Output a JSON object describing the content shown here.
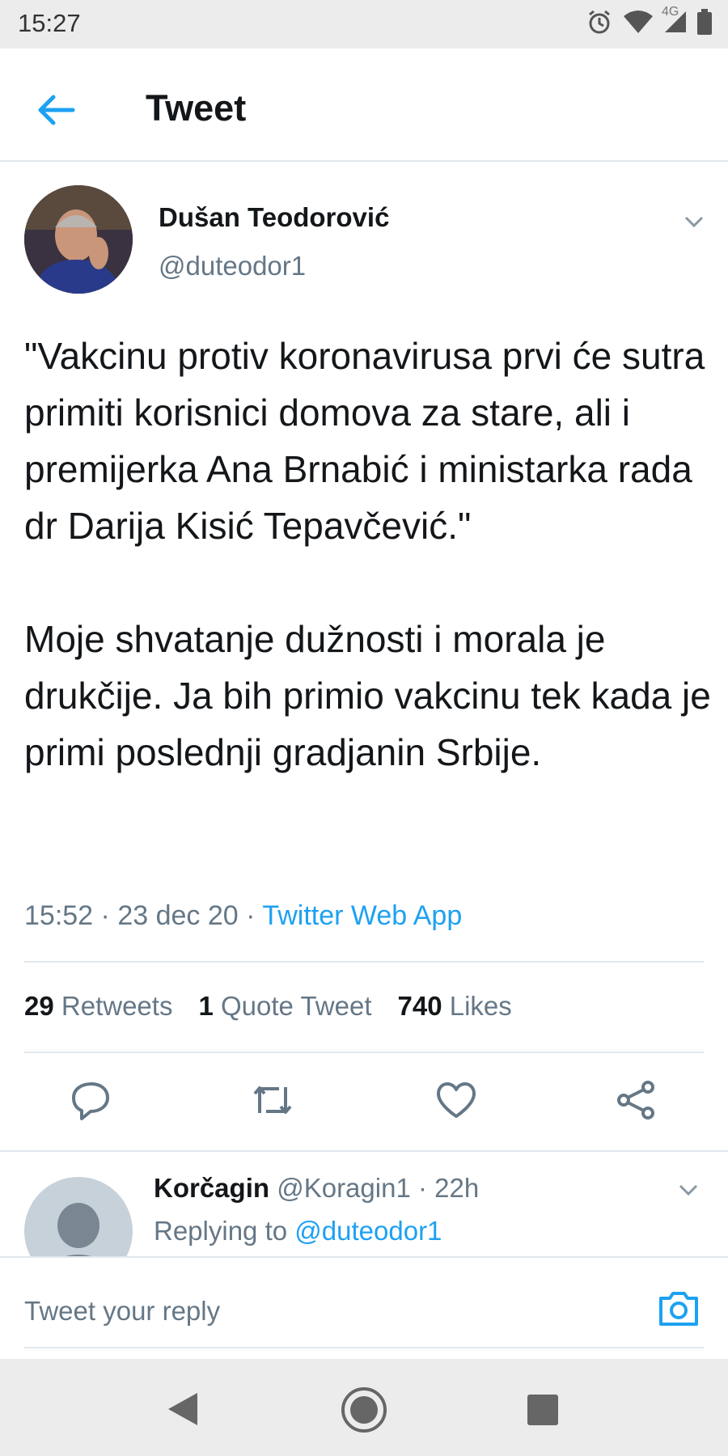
{
  "status_bar": {
    "time": "15:27",
    "network": "4G",
    "icons": [
      "alarm-icon",
      "wifi-icon",
      "signal-icon",
      "battery-icon"
    ]
  },
  "header": {
    "title": "Tweet",
    "back_icon": "arrow-left-icon"
  },
  "tweet": {
    "author_name": "Dušan Teodorović",
    "author_handle": "@duteodor1",
    "text": "\"Vakcinu protiv koronavirusa prvi će sutra primiti korisnici domova za stare, ali i premijerka Ana Brnabić i ministarka rada dr Darija Kisić Tepavčević.\"\n\nMoje shvatanje dužnosti i morala je drukčije. Ja bih primio vakcinu tek kada je primi poslednji gradjanin Srbije.",
    "time": "15:52",
    "date": "23 dec 20",
    "source": "Twitter Web App",
    "separator": "·",
    "stats": {
      "retweets_count": "29",
      "retweets_label": "Retweets",
      "quotes_count": "1",
      "quotes_label": "Quote Tweet",
      "likes_count": "740",
      "likes_label": "Likes"
    },
    "actions": [
      "reply-icon",
      "retweet-icon",
      "like-icon",
      "share-icon"
    ]
  },
  "reply": {
    "author_name": "Korčagin",
    "author_handle": "@Koragin1",
    "time": "22h",
    "separator": "·",
    "replying_to_label": "Replying to",
    "replying_to_handle": "@duteodor1"
  },
  "composer": {
    "placeholder": "Tweet your reply",
    "camera_icon": "camera-icon"
  },
  "colors": {
    "accent": "#1da1f2",
    "text": "#14171a",
    "secondary": "#657786",
    "divider": "#e1e8ed"
  }
}
